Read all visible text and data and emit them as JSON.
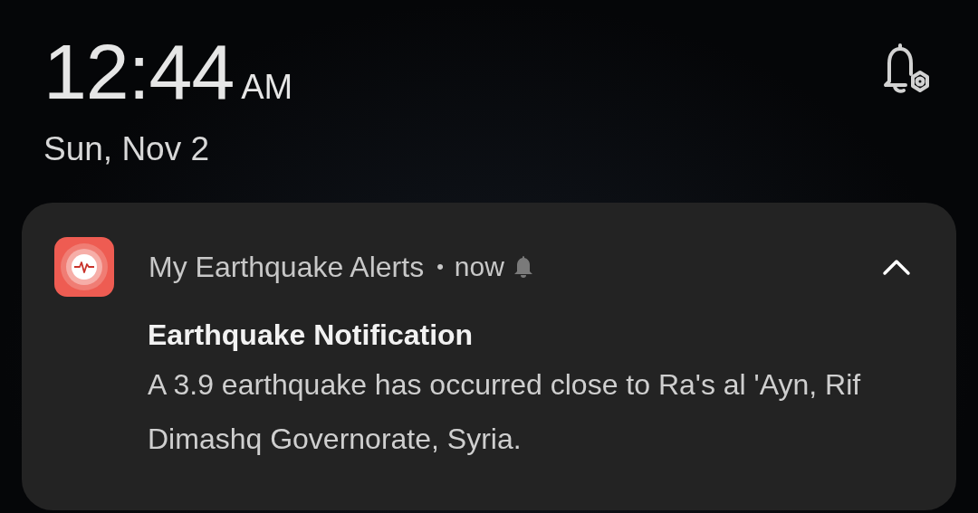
{
  "lock_screen": {
    "time": "12:44",
    "meridiem": "AM",
    "date": "Sun, Nov 2"
  },
  "notification": {
    "app_name": "My Earthquake Alerts",
    "separator": "•",
    "time": "now",
    "expanded": true,
    "title": "Earthquake Notification",
    "body": "A 3.9 earthquake has occurred close to Ra's al 'Ayn, Rif Dimashq Governorate, Syria."
  }
}
